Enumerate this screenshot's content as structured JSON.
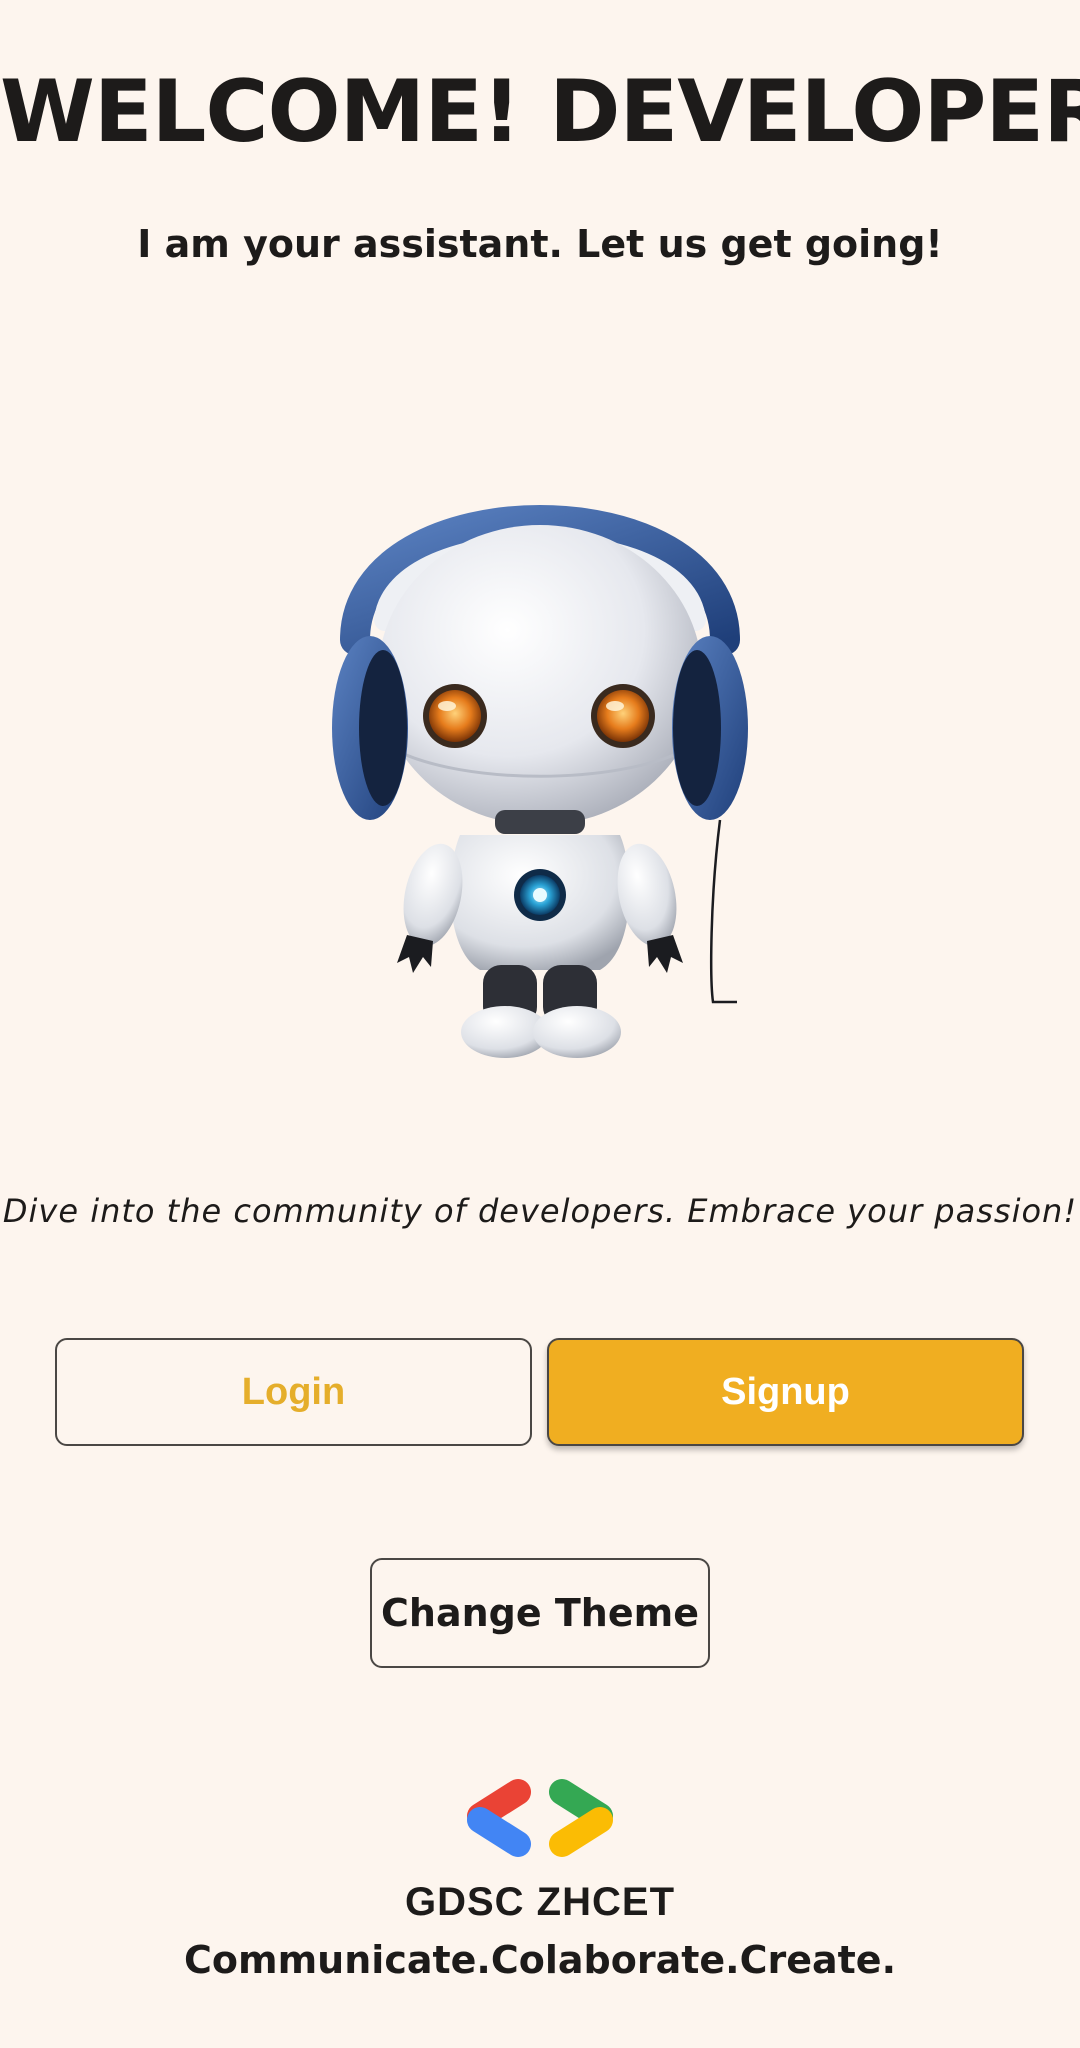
{
  "header": {
    "title": "WELCOME! DEVELOPER",
    "subtitle": "I am your assistant. Let us get going!"
  },
  "hero": {
    "image": "robot-with-headphones-illustration"
  },
  "tagline": "Dive into the community of developers. Embrace your passion!",
  "actions": {
    "login_label": "Login",
    "signup_label": "Signup",
    "theme_label": "Change Theme"
  },
  "footer": {
    "logo": "gdsc-logo-icon",
    "org_name": "GDSC ZHCET",
    "motto": "Communicate.Colaborate.Create."
  },
  "colors": {
    "background": "#FDF5EE",
    "accent": "#F0AE21",
    "text": "#1d1b1a"
  }
}
